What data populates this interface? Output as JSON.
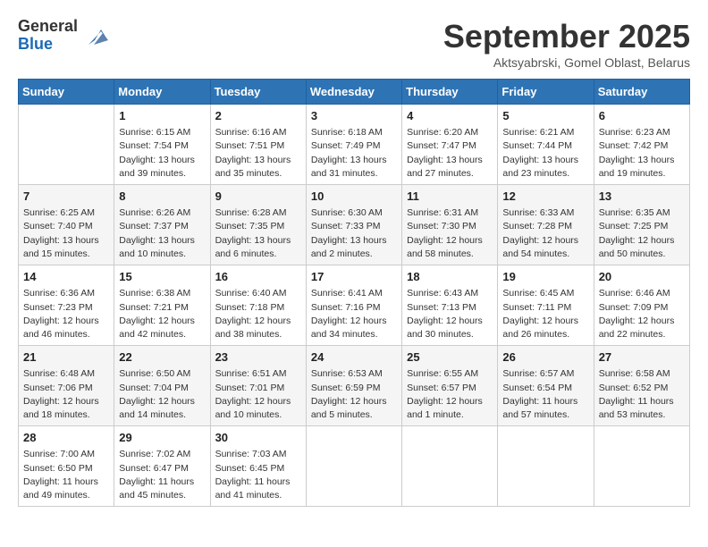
{
  "header": {
    "logo_general": "General",
    "logo_blue": "Blue",
    "month_title": "September 2025",
    "location": "Aktsyabrski, Gomel Oblast, Belarus"
  },
  "weekdays": [
    "Sunday",
    "Monday",
    "Tuesday",
    "Wednesday",
    "Thursday",
    "Friday",
    "Saturday"
  ],
  "weeks": [
    {
      "shade": "white",
      "days": [
        {
          "num": "",
          "info": ""
        },
        {
          "num": "1",
          "info": "Sunrise: 6:15 AM\nSunset: 7:54 PM\nDaylight: 13 hours\nand 39 minutes."
        },
        {
          "num": "2",
          "info": "Sunrise: 6:16 AM\nSunset: 7:51 PM\nDaylight: 13 hours\nand 35 minutes."
        },
        {
          "num": "3",
          "info": "Sunrise: 6:18 AM\nSunset: 7:49 PM\nDaylight: 13 hours\nand 31 minutes."
        },
        {
          "num": "4",
          "info": "Sunrise: 6:20 AM\nSunset: 7:47 PM\nDaylight: 13 hours\nand 27 minutes."
        },
        {
          "num": "5",
          "info": "Sunrise: 6:21 AM\nSunset: 7:44 PM\nDaylight: 13 hours\nand 23 minutes."
        },
        {
          "num": "6",
          "info": "Sunrise: 6:23 AM\nSunset: 7:42 PM\nDaylight: 13 hours\nand 19 minutes."
        }
      ]
    },
    {
      "shade": "shade",
      "days": [
        {
          "num": "7",
          "info": "Sunrise: 6:25 AM\nSunset: 7:40 PM\nDaylight: 13 hours\nand 15 minutes."
        },
        {
          "num": "8",
          "info": "Sunrise: 6:26 AM\nSunset: 7:37 PM\nDaylight: 13 hours\nand 10 minutes."
        },
        {
          "num": "9",
          "info": "Sunrise: 6:28 AM\nSunset: 7:35 PM\nDaylight: 13 hours\nand 6 minutes."
        },
        {
          "num": "10",
          "info": "Sunrise: 6:30 AM\nSunset: 7:33 PM\nDaylight: 13 hours\nand 2 minutes."
        },
        {
          "num": "11",
          "info": "Sunrise: 6:31 AM\nSunset: 7:30 PM\nDaylight: 12 hours\nand 58 minutes."
        },
        {
          "num": "12",
          "info": "Sunrise: 6:33 AM\nSunset: 7:28 PM\nDaylight: 12 hours\nand 54 minutes."
        },
        {
          "num": "13",
          "info": "Sunrise: 6:35 AM\nSunset: 7:25 PM\nDaylight: 12 hours\nand 50 minutes."
        }
      ]
    },
    {
      "shade": "white",
      "days": [
        {
          "num": "14",
          "info": "Sunrise: 6:36 AM\nSunset: 7:23 PM\nDaylight: 12 hours\nand 46 minutes."
        },
        {
          "num": "15",
          "info": "Sunrise: 6:38 AM\nSunset: 7:21 PM\nDaylight: 12 hours\nand 42 minutes."
        },
        {
          "num": "16",
          "info": "Sunrise: 6:40 AM\nSunset: 7:18 PM\nDaylight: 12 hours\nand 38 minutes."
        },
        {
          "num": "17",
          "info": "Sunrise: 6:41 AM\nSunset: 7:16 PM\nDaylight: 12 hours\nand 34 minutes."
        },
        {
          "num": "18",
          "info": "Sunrise: 6:43 AM\nSunset: 7:13 PM\nDaylight: 12 hours\nand 30 minutes."
        },
        {
          "num": "19",
          "info": "Sunrise: 6:45 AM\nSunset: 7:11 PM\nDaylight: 12 hours\nand 26 minutes."
        },
        {
          "num": "20",
          "info": "Sunrise: 6:46 AM\nSunset: 7:09 PM\nDaylight: 12 hours\nand 22 minutes."
        }
      ]
    },
    {
      "shade": "shade",
      "days": [
        {
          "num": "21",
          "info": "Sunrise: 6:48 AM\nSunset: 7:06 PM\nDaylight: 12 hours\nand 18 minutes."
        },
        {
          "num": "22",
          "info": "Sunrise: 6:50 AM\nSunset: 7:04 PM\nDaylight: 12 hours\nand 14 minutes."
        },
        {
          "num": "23",
          "info": "Sunrise: 6:51 AM\nSunset: 7:01 PM\nDaylight: 12 hours\nand 10 minutes."
        },
        {
          "num": "24",
          "info": "Sunrise: 6:53 AM\nSunset: 6:59 PM\nDaylight: 12 hours\nand 5 minutes."
        },
        {
          "num": "25",
          "info": "Sunrise: 6:55 AM\nSunset: 6:57 PM\nDaylight: 12 hours\nand 1 minute."
        },
        {
          "num": "26",
          "info": "Sunrise: 6:57 AM\nSunset: 6:54 PM\nDaylight: 11 hours\nand 57 minutes."
        },
        {
          "num": "27",
          "info": "Sunrise: 6:58 AM\nSunset: 6:52 PM\nDaylight: 11 hours\nand 53 minutes."
        }
      ]
    },
    {
      "shade": "white",
      "days": [
        {
          "num": "28",
          "info": "Sunrise: 7:00 AM\nSunset: 6:50 PM\nDaylight: 11 hours\nand 49 minutes."
        },
        {
          "num": "29",
          "info": "Sunrise: 7:02 AM\nSunset: 6:47 PM\nDaylight: 11 hours\nand 45 minutes."
        },
        {
          "num": "30",
          "info": "Sunrise: 7:03 AM\nSunset: 6:45 PM\nDaylight: 11 hours\nand 41 minutes."
        },
        {
          "num": "",
          "info": ""
        },
        {
          "num": "",
          "info": ""
        },
        {
          "num": "",
          "info": ""
        },
        {
          "num": "",
          "info": ""
        }
      ]
    }
  ]
}
